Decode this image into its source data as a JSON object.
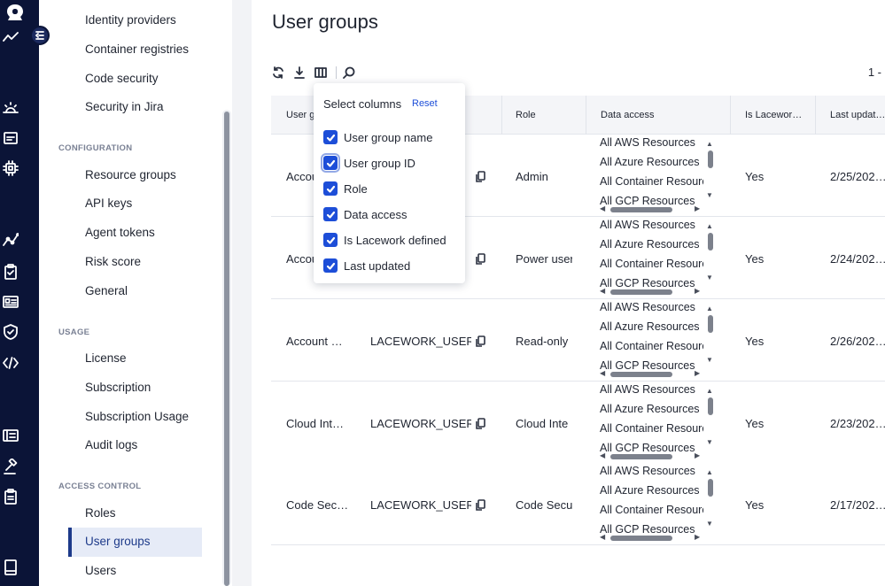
{
  "rail": {
    "icons": [
      "logo-icon",
      "activity-icon",
      "alerts-icon",
      "dashboard-icon",
      "chip-icon",
      "graph-icon",
      "compliance-icon",
      "id-card-icon",
      "shield-icon",
      "code-icon",
      "reports-icon",
      "gavel-icon",
      "clipboard-icon",
      "book-icon"
    ]
  },
  "sidebar": {
    "top_items": [
      "Identity providers",
      "Container registries",
      "Code security",
      "Security in Jira"
    ],
    "configuration": {
      "heading": "CONFIGURATION",
      "items": [
        "Resource groups",
        "API keys",
        "Agent tokens",
        "Risk score",
        "General"
      ]
    },
    "usage": {
      "heading": "USAGE",
      "items": [
        "License",
        "Subscription",
        "Subscription Usage",
        "Audit logs"
      ]
    },
    "access_control": {
      "heading": "ACCESS CONTROL",
      "items": [
        "Roles",
        "User groups",
        "Users"
      ],
      "active": "User groups"
    }
  },
  "main": {
    "title": "User groups",
    "toolbar": [
      "refresh-icon",
      "download-icon",
      "columns-icon",
      "search-icon"
    ],
    "pager_text": "1 -"
  },
  "table": {
    "headers": [
      "User g",
      "",
      "Role",
      "Data access",
      "Is Lacewor…",
      "Last updat…"
    ],
    "rows": [
      {
        "name": "Accou",
        "id": "…",
        "role": "Admin",
        "lacework": "Yes",
        "updated": "2/25/202…"
      },
      {
        "name": "Accou",
        "id": "…",
        "role": "Power user",
        "lacework": "Yes",
        "updated": "2/24/202…"
      },
      {
        "name": "Account …",
        "id": "LACEWORK_USER…",
        "role": "Read-only",
        "lacework": "Yes",
        "updated": "2/26/202…"
      },
      {
        "name": "Cloud Int…",
        "id": "LACEWORK_USER…",
        "role": "Cloud Inte",
        "lacework": "Yes",
        "updated": "2/23/202…"
      },
      {
        "name": "Code Sec…",
        "id": "LACEWORK_USER…",
        "role": "Code Secu",
        "lacework": "Yes",
        "updated": "2/17/202…"
      }
    ],
    "data_access_lines": [
      "All AWS Resources",
      "All Azure Resources",
      "All Container Resources",
      "All GCP Resources"
    ]
  },
  "popover": {
    "title": "Select columns",
    "reset": "Reset",
    "options": [
      "User group name",
      "User group ID",
      "Role",
      "Data access",
      "Is Lacework defined",
      "Last updated"
    ]
  },
  "colors": {
    "rail": "#0b1437",
    "accent": "#1d4ed8",
    "active_bg": "#e6ebf7"
  }
}
